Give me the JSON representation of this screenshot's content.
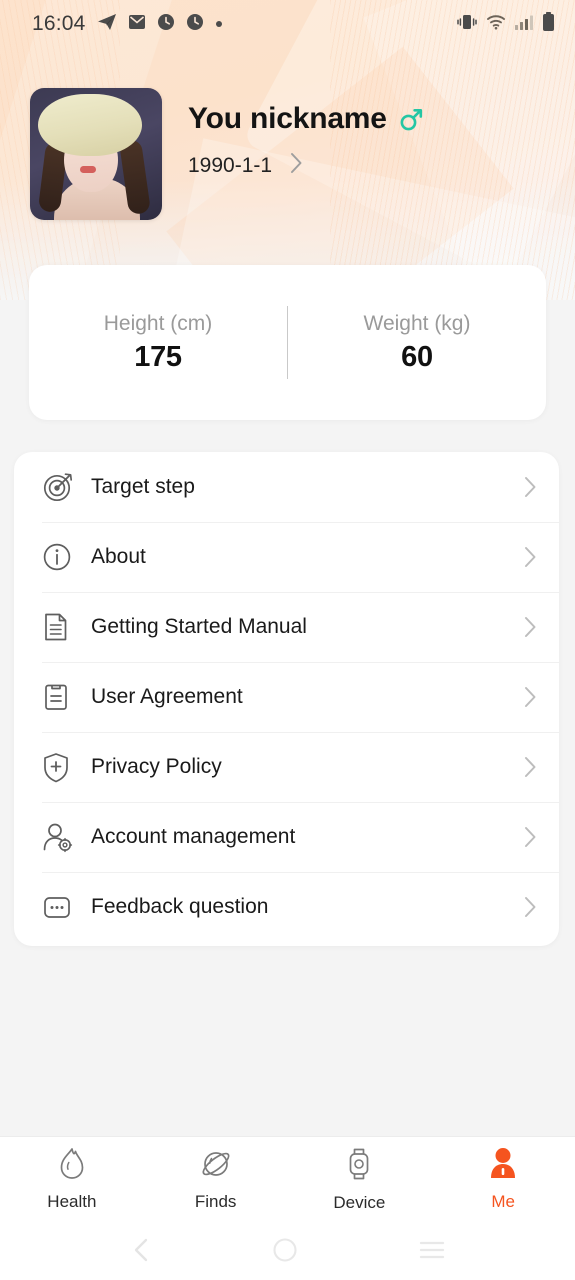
{
  "status_bar": {
    "time": "16:04",
    "left_icons": [
      "telegram-icon",
      "mail-icon",
      "clock-icon",
      "clock-icon",
      "dot-icon"
    ],
    "right_icons": [
      "vibrate-icon",
      "wifi-icon",
      "cellular-signal-icon",
      "battery-icon"
    ]
  },
  "profile": {
    "nickname": "You nickname",
    "gender_symbol": "♂",
    "gender_color": "#23c6a4",
    "birthdate": "1990-1-1",
    "avatar_alt": "user-avatar-photo"
  },
  "metrics": [
    {
      "label": "Height (cm)",
      "value": "175"
    },
    {
      "label": "Weight (kg)",
      "value": "60"
    }
  ],
  "menu": {
    "items": [
      {
        "label": "Target step",
        "icon": "target-icon"
      },
      {
        "label": "About",
        "icon": "info-icon"
      },
      {
        "label": "Getting Started Manual",
        "icon": "document-icon"
      },
      {
        "label": "User Agreement",
        "icon": "clipboard-icon"
      },
      {
        "label": "Privacy Policy",
        "icon": "shield-plus-icon"
      },
      {
        "label": "Account management",
        "icon": "person-gear-icon"
      },
      {
        "label": "Feedback question",
        "icon": "dots-box-icon"
      }
    ]
  },
  "bottom_nav": {
    "active": "Me",
    "active_color": "#f5541f",
    "items": [
      {
        "label": "Health",
        "icon": "flame-icon"
      },
      {
        "label": "Finds",
        "icon": "planet-icon"
      },
      {
        "label": "Device",
        "icon": "smartwatch-icon"
      },
      {
        "label": "Me",
        "icon": "person-icon"
      }
    ]
  },
  "android_nav": {
    "back": "back-icon",
    "home": "home-icon",
    "recents": "recents-icon"
  }
}
